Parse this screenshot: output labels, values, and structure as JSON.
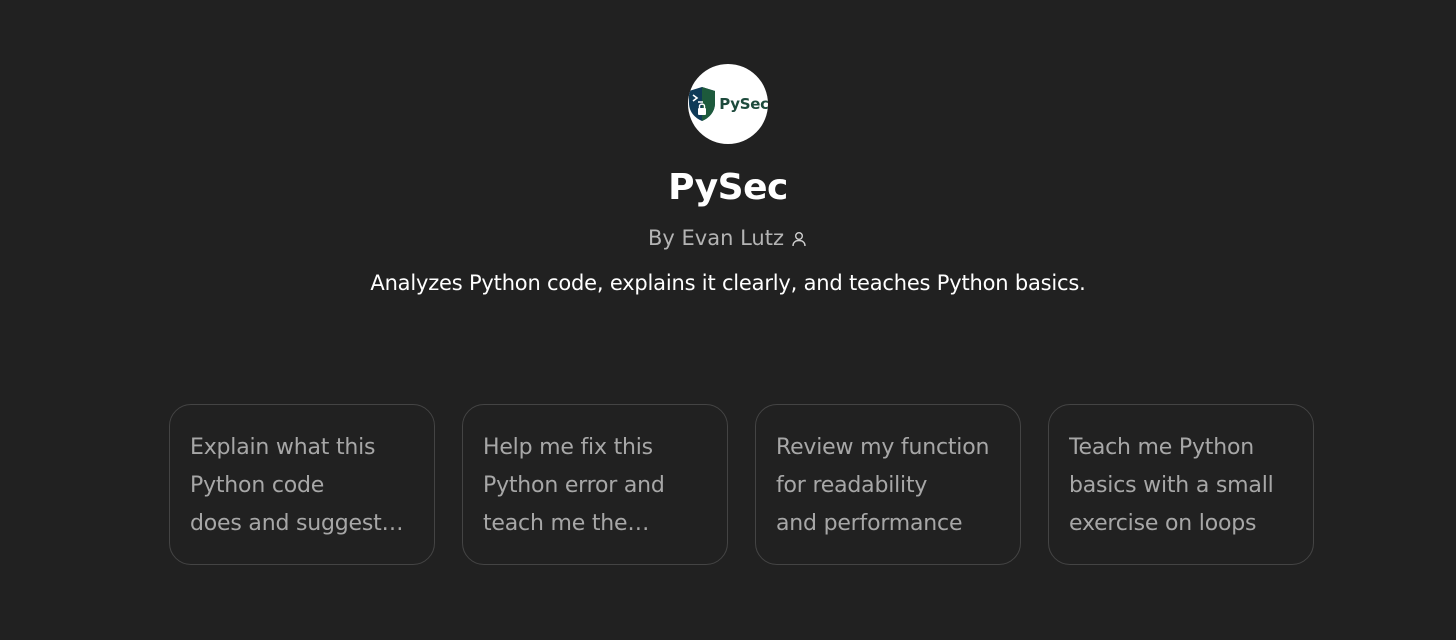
{
  "gpt": {
    "logo_text": "PySec",
    "title": "PySec",
    "byline": "By Evan Lutz",
    "description": "Analyzes Python code, explains it clearly, and teaches Python basics."
  },
  "icons": {
    "logo": "shield-terminal-lock-icon",
    "author": "person-icon"
  },
  "colors": {
    "background": "#212121",
    "card_border": "#444444",
    "logo_green": "#1d4a3c",
    "logo_navy": "#0f3a57"
  },
  "starters": [
    {
      "lines": [
        "Explain what this",
        "Python code",
        "does and suggest…"
      ]
    },
    {
      "lines": [
        "Help me fix this",
        "Python error and",
        "teach me the…"
      ]
    },
    {
      "lines": [
        "Review my function",
        "for readability",
        "and performance"
      ]
    },
    {
      "lines": [
        "Teach me Python",
        "basics with a small",
        "exercise on loops"
      ]
    }
  ]
}
